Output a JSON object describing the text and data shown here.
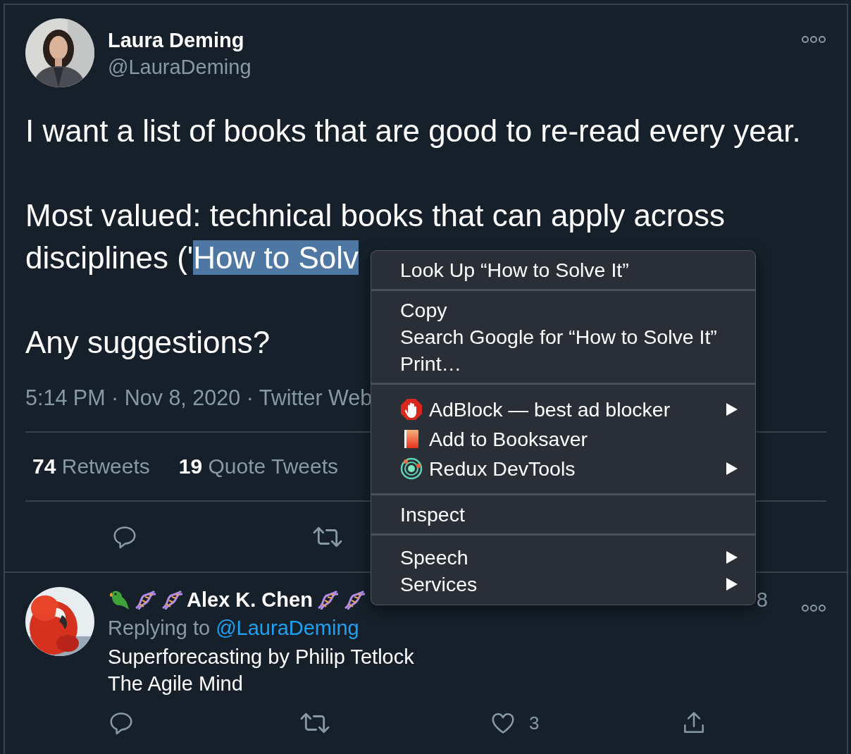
{
  "tweet": {
    "author": {
      "name": "Laura Deming",
      "handle": "@LauraDeming"
    },
    "paragraphs": [
      {
        "lines": [
          "I want a list of books that are good to re-read every year."
        ]
      },
      {
        "lines": [
          "Most valued: technical books that can apply across",
          "disciplines ('"
        ],
        "selection": "How to Solv"
      },
      {
        "lines": [
          "Any suggestions?"
        ]
      }
    ],
    "timestamp": "5:14 PM · Nov 8, 2020 · Twitter Web",
    "stats": [
      {
        "count": "74",
        "label": "Retweets"
      },
      {
        "count": "19",
        "label": "Quote Tweets"
      }
    ],
    "actions": [
      {
        "kind": "reply"
      },
      {
        "kind": "retweet"
      }
    ]
  },
  "reply": {
    "author": {
      "name": "Alex K. Chen"
    },
    "date_fragment": "8",
    "replying_to": "Replying to",
    "mention": "@LauraDeming",
    "lines": [
      "Superforecasting by Philip Tetlock",
      "The Agile Mind"
    ],
    "actions": [
      {
        "kind": "reply"
      },
      {
        "kind": "retweet"
      },
      {
        "kind": "like",
        "count": "3"
      },
      {
        "kind": "share"
      }
    ]
  },
  "context_menu": {
    "groups": [
      {
        "items": [
          {
            "label": "Look Up “How to Solve It”",
            "submenu": false
          }
        ]
      },
      {
        "items": [
          {
            "label": "Copy",
            "submenu": false
          },
          {
            "label": "Search Google for “How to Solve It”",
            "submenu": false
          },
          {
            "label": "Print…",
            "submenu": false
          }
        ]
      },
      {
        "items": [
          {
            "label": "AdBlock — best ad blocker",
            "kind": "adblock",
            "submenu": true
          },
          {
            "label": "Add to Booksaver",
            "kind": "book",
            "submenu": false
          },
          {
            "label": "Redux DevTools",
            "kind": "redux",
            "submenu": true
          }
        ]
      },
      {
        "items": [
          {
            "label": "Inspect",
            "submenu": false
          }
        ]
      },
      {
        "items": [
          {
            "label": "Speech",
            "submenu": true
          },
          {
            "label": "Services",
            "submenu": true
          }
        ]
      }
    ]
  }
}
